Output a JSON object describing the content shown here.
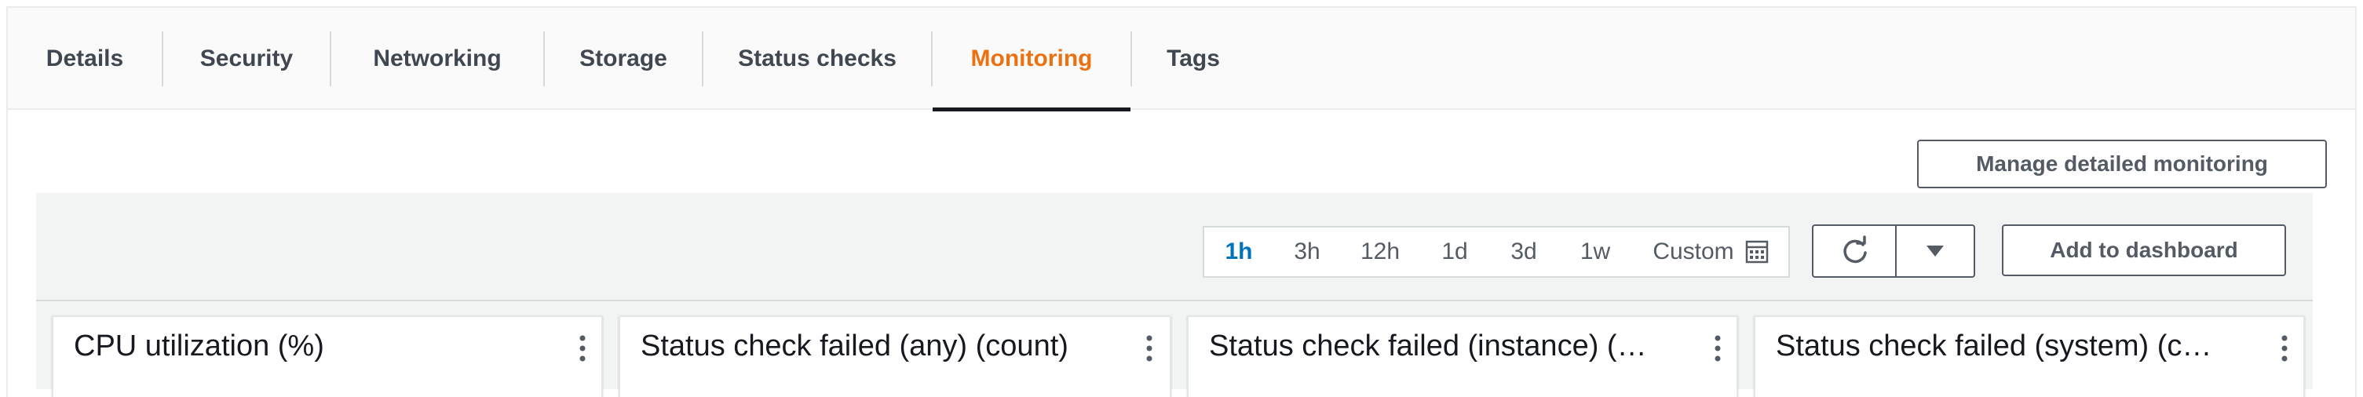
{
  "tabs": [
    {
      "label": "Details"
    },
    {
      "label": "Security"
    },
    {
      "label": "Networking"
    },
    {
      "label": "Storage"
    },
    {
      "label": "Status checks"
    },
    {
      "label": "Monitoring"
    },
    {
      "label": "Tags"
    }
  ],
  "active_tab": "Monitoring",
  "colors": {
    "accent": "#ec7211",
    "link_blue": "#0073bb"
  },
  "monitoring": {
    "manage_button": "Manage detailed monitoring",
    "time_ranges": [
      "1h",
      "3h",
      "12h",
      "1d",
      "3d",
      "1w"
    ],
    "active_range": "1h",
    "custom_label": "Custom",
    "custom_icon": "calendar-icon",
    "refresh_icon": "refresh-icon",
    "dropdown_icon": "caret-down-icon",
    "add_dashboard_button": "Add to dashboard"
  },
  "widgets": [
    {
      "title": "CPU utilization (%)"
    },
    {
      "title": "Status check failed (any) (count)"
    },
    {
      "title": "Status check failed (instance) (…"
    },
    {
      "title": "Status check failed (system) (c…"
    }
  ]
}
